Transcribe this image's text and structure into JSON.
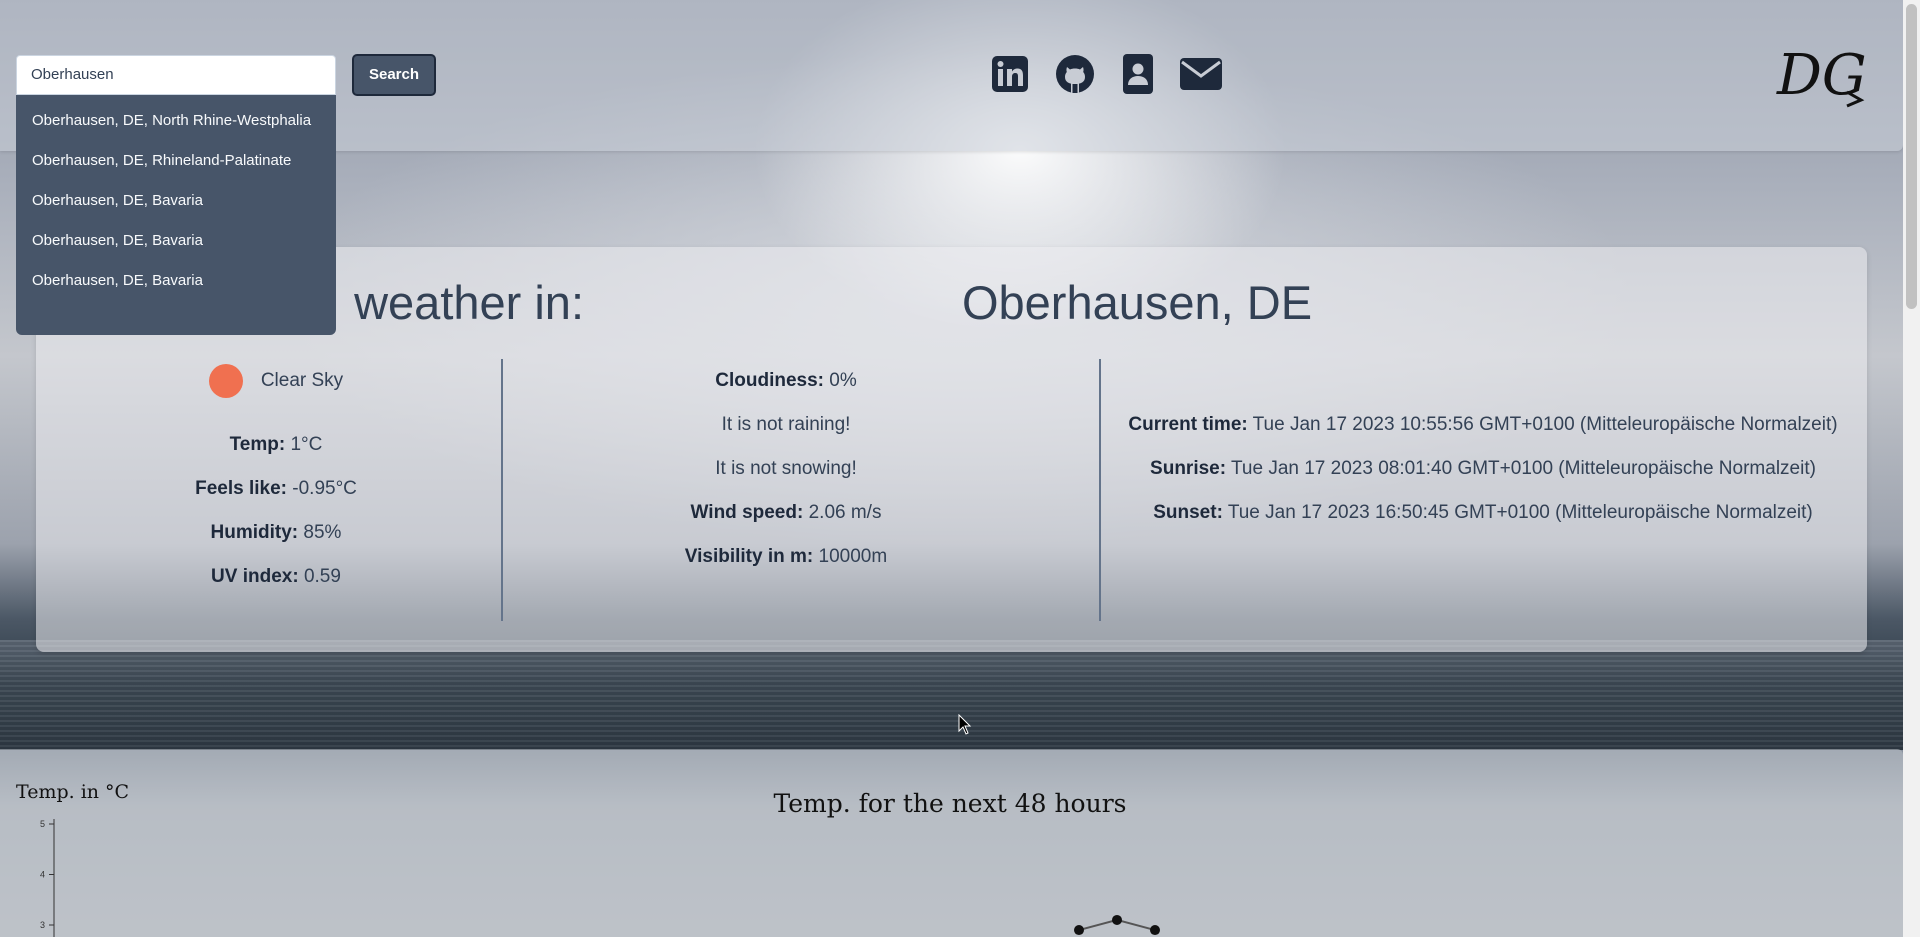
{
  "search": {
    "value": "Oberhausen",
    "button_label": "Search"
  },
  "suggestions": [
    "Oberhausen, DE, North Rhine-Westphalia",
    "Oberhausen, DE, Rhineland-Palatinate",
    "Oberhausen, DE, Bavaria",
    "Oberhausen, DE, Bavaria",
    "Oberhausen, DE, Bavaria"
  ],
  "social_icons": [
    "linkedin-icon",
    "github-icon",
    "contact-card-icon",
    "envelope-icon"
  ],
  "logo": {
    "text": "DG"
  },
  "weather": {
    "title_left": "weather in:",
    "location": "Oberhausen, DE",
    "condition": "Clear Sky",
    "condition_color": "#f07050",
    "temp_label": "Temp:",
    "temp_value": "1°C",
    "feels_label": "Feels like:",
    "feels_value": "-0.95°C",
    "humidity_label": "Humidity:",
    "humidity_value": "85%",
    "uv_label": "UV index:",
    "uv_value": "0.59",
    "cloudiness_label": "Cloudiness:",
    "cloudiness_value": "0%",
    "rain_text": "It is not raining!",
    "snow_text": "It is not snowing!",
    "wind_label": "Wind speed:",
    "wind_value": "2.06 m/s",
    "visibility_label": "Visibility in m:",
    "visibility_value": "10000m",
    "current_time_label": "Current time:",
    "current_time_value": "Tue Jan 17 2023 10:55:56 GMT+0100 (Mitteleuropäische Normalzeit)",
    "sunrise_label": "Sunrise:",
    "sunrise_value": "Tue Jan 17 2023 08:01:40 GMT+0100 (Mitteleuropäische Normalzeit)",
    "sunset_label": "Sunset:",
    "sunset_value": "Tue Jan 17 2023 16:50:45 GMT+0100 (Mitteleuropäische Normalzeit)"
  },
  "colors": {
    "accent": "#475569",
    "text": "#334155"
  },
  "chart_data": {
    "type": "line",
    "title": "Temp. for the next 48 hours",
    "ylabel": "Temp. in °C",
    "xlabel": "",
    "y_ticks": [
      "5",
      "4",
      "3"
    ],
    "ylim": [
      3,
      5
    ],
    "series": [
      {
        "values": [
          2.9,
          3.1,
          2.9
        ]
      }
    ]
  }
}
